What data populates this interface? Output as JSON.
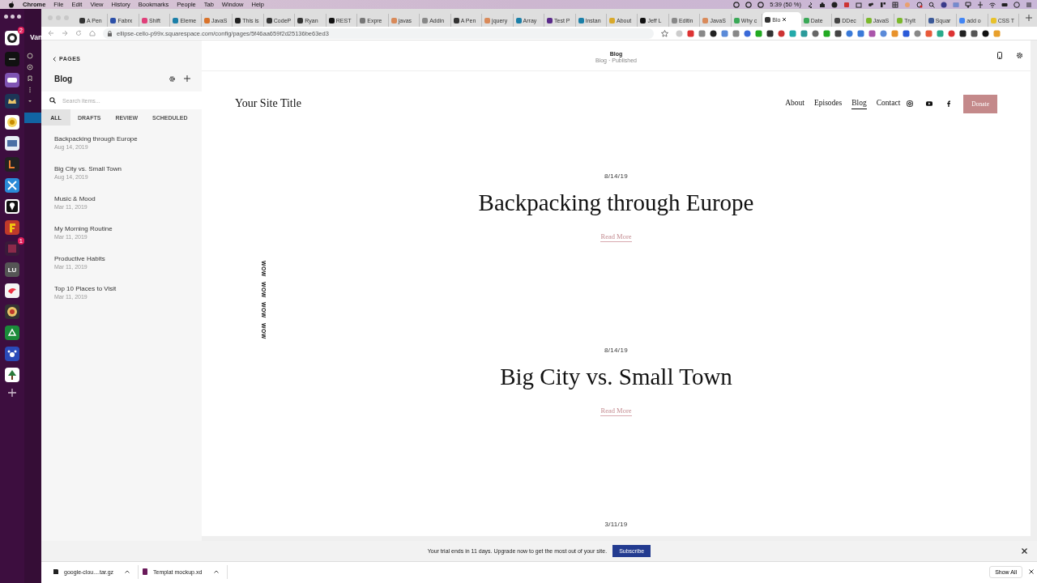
{
  "menu_bar": {
    "app": "Chrome",
    "items": [
      "File",
      "Edit",
      "View",
      "History",
      "Bookmarks",
      "People",
      "Tab",
      "Window",
      "Help"
    ],
    "status": "5:39 (50 %)"
  },
  "dock": {
    "workspace": "Van",
    "apps": [
      {
        "kind": "logo",
        "badge": "2",
        "selected": false
      },
      {
        "kind": "dark",
        "selected": false
      },
      {
        "kind": "woo",
        "selected": false
      },
      {
        "kind": "crown",
        "selected": false
      },
      {
        "kind": "coin",
        "selected": false
      },
      {
        "kind": "sticker",
        "selected": false
      },
      {
        "kind": "letter",
        "selected": false
      },
      {
        "kind": "cross",
        "selected": false
      },
      {
        "kind": "cone",
        "selected": true
      },
      {
        "kind": "flame",
        "selected": false
      },
      {
        "kind": "square",
        "badge": "1",
        "selected": false
      },
      {
        "kind": "text",
        "label": "LU",
        "selected": false
      },
      {
        "kind": "bird",
        "selected": false
      },
      {
        "kind": "round",
        "selected": false
      },
      {
        "kind": "green",
        "selected": false
      },
      {
        "kind": "paw",
        "selected": false
      },
      {
        "kind": "tree",
        "selected": false
      },
      {
        "kind": "add",
        "selected": false
      }
    ]
  },
  "browser": {
    "tabs": [
      {
        "title": "A Pen",
        "color": "#333333",
        "selected": false
      },
      {
        "title": "Fabrx",
        "color": "#2b4fa8",
        "selected": false
      },
      {
        "title": "Shift",
        "color": "#e0407a",
        "selected": false
      },
      {
        "title": "Eleme",
        "color": "#1b7fa8",
        "selected": false
      },
      {
        "title": "JavaS",
        "color": "#d9732b",
        "selected": false
      },
      {
        "title": "This is",
        "color": "#222222",
        "selected": false
      },
      {
        "title": "CodeP",
        "color": "#333333",
        "selected": false
      },
      {
        "title": "Ryan",
        "color": "#333333",
        "selected": false
      },
      {
        "title": "REST",
        "color": "#111111",
        "selected": false
      },
      {
        "title": "Expre",
        "color": "#777777",
        "selected": false
      },
      {
        "title": "javas",
        "color": "#d98a5a",
        "selected": false
      },
      {
        "title": "Addin",
        "color": "#888888",
        "selected": false
      },
      {
        "title": "A Pen",
        "color": "#333333",
        "selected": false
      },
      {
        "title": "jquery",
        "color": "#d98a5a",
        "selected": false
      },
      {
        "title": "Array",
        "color": "#1b7fa8",
        "selected": false
      },
      {
        "title": "Test P",
        "color": "#5a2a8a",
        "selected": false
      },
      {
        "title": "Instan",
        "color": "#1b7fa8",
        "selected": false
      },
      {
        "title": "About",
        "color": "#d9a92b",
        "selected": false
      },
      {
        "title": "Jeff L",
        "color": "#111111",
        "selected": false
      },
      {
        "title": "Editin",
        "color": "#888888",
        "selected": false
      },
      {
        "title": "JavaS",
        "color": "#d98a5a",
        "selected": false
      },
      {
        "title": "Why c",
        "color": "#3aa857",
        "selected": false
      },
      {
        "title": "Blo",
        "color": "#333333",
        "selected": true
      },
      {
        "title": "Date",
        "color": "#3aa857",
        "selected": false
      },
      {
        "title": "DDec",
        "color": "#444444",
        "selected": false
      },
      {
        "title": "JavaS",
        "color": "#7ab82b",
        "selected": false
      },
      {
        "title": "TryIt",
        "color": "#7ab82b",
        "selected": false
      },
      {
        "title": "Squar",
        "color": "#3b5998",
        "selected": false
      },
      {
        "title": "add o",
        "color": "#4285f4",
        "selected": false
      },
      {
        "title": "CSS T",
        "color": "#e8c22b",
        "selected": false
      }
    ],
    "url": "ellipse-cello-p99x.squarespace.com/config/pages/5f46aa659f2d25136be63ed3"
  },
  "sidebar": {
    "back": "PAGES",
    "title": "Blog",
    "search": {
      "placeholder": "Search items..."
    },
    "filters": [
      {
        "label": "ALL",
        "selected": true
      },
      {
        "label": "DRAFTS",
        "selected": false
      },
      {
        "label": "REVIEW",
        "selected": false
      },
      {
        "label": "SCHEDULED",
        "selected": false
      }
    ],
    "items": [
      {
        "title": "Backpacking through Europe",
        "date": "Aug 14, 2019"
      },
      {
        "title": "Big City vs. Small Town",
        "date": "Aug 14, 2019"
      },
      {
        "title": "Music & Mood",
        "date": "Mar 11, 2019"
      },
      {
        "title": "My Morning Routine",
        "date": "Mar 11, 2019"
      },
      {
        "title": "Productive Habits",
        "date": "Mar 11, 2019"
      },
      {
        "title": "Top 10 Places to Visit",
        "date": "Mar 11, 2019"
      }
    ]
  },
  "preview": {
    "title": "Blog",
    "subtitle": "Blog · Published",
    "site_title": "Your Site Title",
    "nav": [
      {
        "label": "About",
        "selected": false
      },
      {
        "label": "Episodes",
        "selected": false
      },
      {
        "label": "Blog",
        "selected": true
      },
      {
        "label": "Contact",
        "selected": false
      }
    ],
    "social": [
      {
        "kind": "instagram"
      },
      {
        "kind": "youtube"
      },
      {
        "kind": "facebook"
      }
    ],
    "donate": "Donate",
    "decoration": [
      "WOW",
      "WOW",
      "WOW",
      "WOW"
    ],
    "posts": [
      {
        "date": "8/14/19",
        "title": "Backpacking through Europe",
        "link": "Read More"
      },
      {
        "date": "8/14/19",
        "title": "Big City vs. Small Town",
        "link": "Read More"
      },
      {
        "date": "3/11/19"
      }
    ]
  },
  "trial_banner": {
    "message": "Your trial ends in 11 days. Upgrade now to get the most out of your site.",
    "button": "Subscribe"
  },
  "downloads": {
    "files": [
      {
        "name": "google-clou....tar.gz",
        "kind": "archive"
      },
      {
        "name": "Templat mockup.xd",
        "kind": "design"
      }
    ],
    "show_all": "Show All"
  }
}
